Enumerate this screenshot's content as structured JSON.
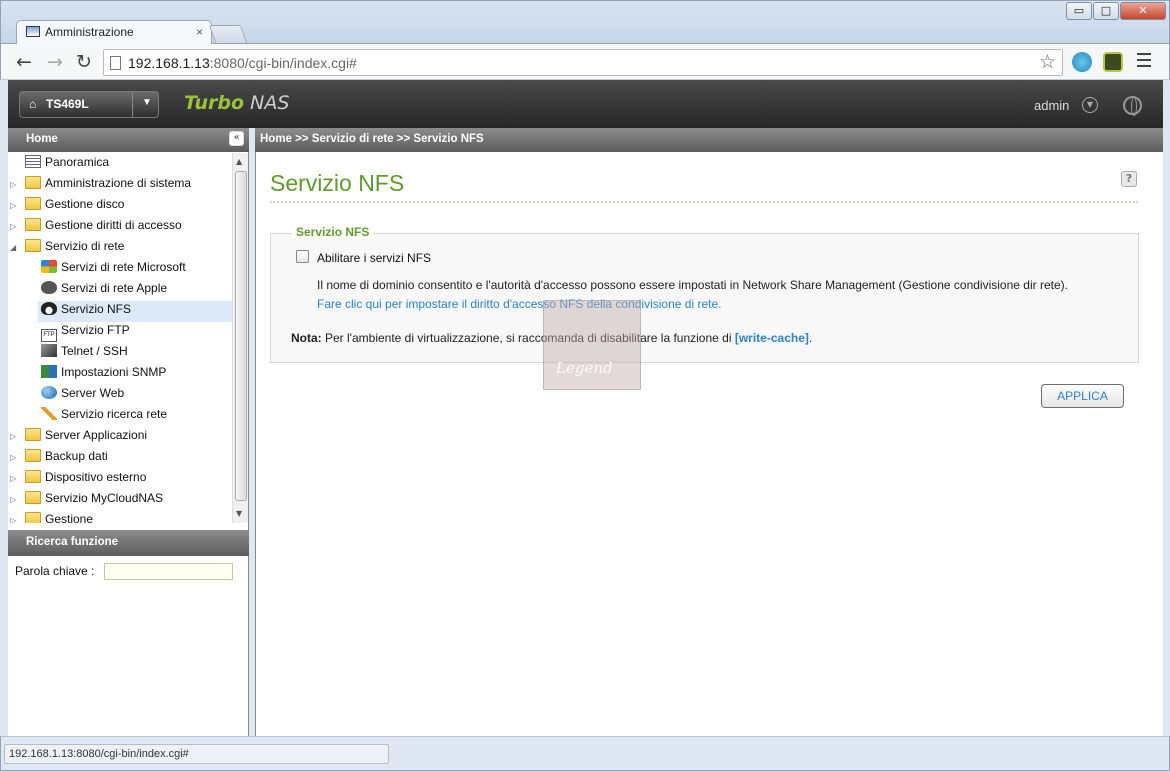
{
  "browser": {
    "tab_title": "Amministrazione",
    "tab_close": "×",
    "url_host": "192.168.1.13",
    "url_rest": ":8080/cgi-bin/index.cgi#",
    "status_url": "192.168.1.13:8080/cgi-bin/index.cgi#",
    "window_min": "▭",
    "window_max": "□",
    "window_close": "✕",
    "back_glyph": "←",
    "forward_glyph": "→",
    "reload_glyph": "↻",
    "star_glyph": "☆"
  },
  "header": {
    "model": "TS469L",
    "brand_part1": "Turbo",
    "brand_part2": " NAS",
    "user": "admin"
  },
  "sidebar": {
    "title": "Home",
    "items": [
      {
        "label": "Panoramica"
      },
      {
        "label": "Amministrazione di sistema"
      },
      {
        "label": "Gestione disco"
      },
      {
        "label": "Gestione diritti di accesso"
      },
      {
        "label": "Servizio di rete"
      },
      {
        "label": "Servizi di rete Microsoft"
      },
      {
        "label": "Servizi di rete Apple"
      },
      {
        "label": "Servizio NFS"
      },
      {
        "label": "Servizio FTP"
      },
      {
        "label": "Telnet / SSH"
      },
      {
        "label": "Impostazioni SNMP"
      },
      {
        "label": "Server Web"
      },
      {
        "label": "Servizio ricerca rete"
      },
      {
        "label": "Server Applicazioni"
      },
      {
        "label": "Backup dati"
      },
      {
        "label": "Dispositivo esterno"
      },
      {
        "label": "Servizio MyCloudNAS"
      },
      {
        "label": "Gestione"
      }
    ],
    "search_title": "Ricerca funzione",
    "keyword_label": "Parola chiave :"
  },
  "breadcrumb": "Home >> Servizio di rete >> Servizio NFS",
  "main": {
    "title": "Servizio NFS",
    "section_legend": "Servizio NFS",
    "enable_label": "Abilitare i servizi NFS",
    "enable_checked": false,
    "description": "Il nome di dominio consentito e l'autorità d'accesso possono essere impostati in Network Share Management (Gestione condivisione dir rete).",
    "link_text": "Fare clic qui per impostare il diritto d'accesso NFS della condivisione di rete.",
    "note_label": "Nota:",
    "note_text": " Per l'ambiente di virtualizzazione, si raccomanda di disabilitare la funzione di ",
    "note_link": "[write-cache]",
    "note_end": ".",
    "apply_label": "APPLICA"
  },
  "watermark": {
    "text": "Legend"
  },
  "colors": {
    "accent_green": "#5e9a2e",
    "link_blue": "#2b82d0"
  }
}
